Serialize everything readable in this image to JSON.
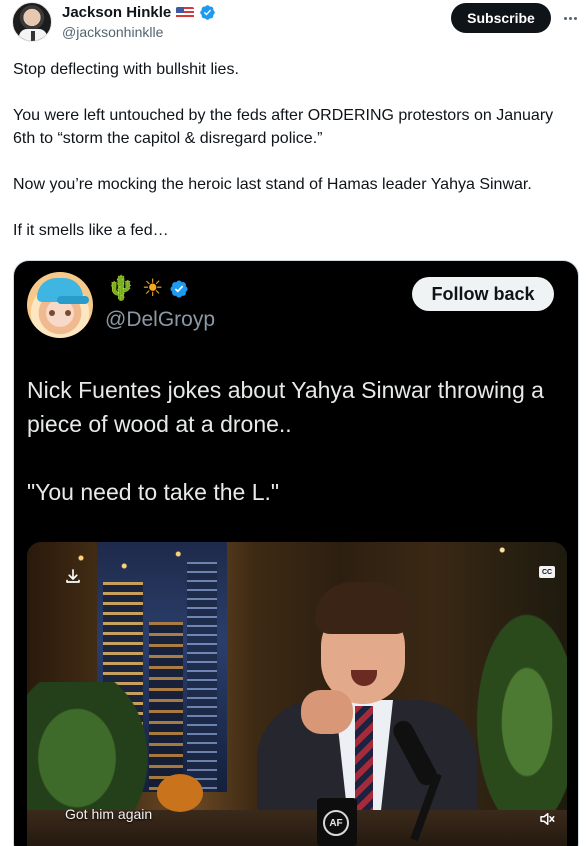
{
  "author": {
    "name": "Jackson Hinkle",
    "flag_icon": "us-flag-icon",
    "handle": "@jacksonhinklle",
    "verified_color": "#1d9bf0"
  },
  "header": {
    "subscribe_label": "Subscribe",
    "more_icon": "more-options-icon"
  },
  "tweet": {
    "paragraphs": [
      "Stop deflecting with bullshit lies.",
      "You were left untouched by the feds after ORDERING protestors on January 6th to “storm the capitol & disregard police.”",
      "Now you’re mocking the heroic last stand of Hamas leader Yahya Sinwar.",
      "If it smells like a fed…"
    ]
  },
  "quoted": {
    "emoji_cactus": "🌵",
    "emoji_sun": "☀",
    "handle": "@DelGroyp",
    "follow_back_label": "Follow back",
    "paragraphs": [
      "Nick Fuentes jokes about Yahya Sinwar throwing a piece of wood at a drone..",
      "\"You need to take the L.\""
    ]
  },
  "video": {
    "caption": "Got him again",
    "cc_label": "CC",
    "mug_logo": "AF"
  },
  "colors": {
    "text": "#0f1419",
    "secondary": "#536471",
    "accent": "#1d9bf0",
    "media_bg": "#000000"
  }
}
